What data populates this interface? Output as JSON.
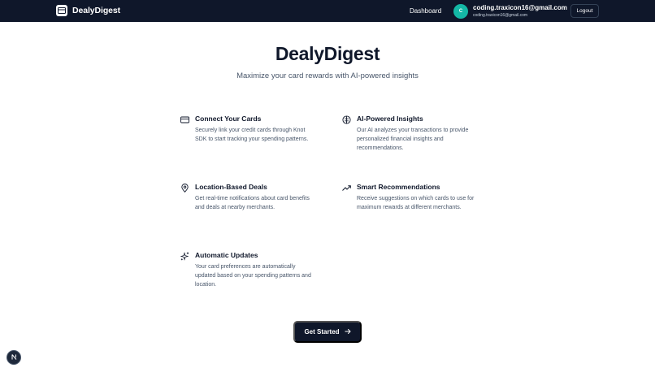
{
  "header": {
    "brand_name": "DealyDigest",
    "nav_dashboard": "Dashboard",
    "avatar_initial": "C",
    "user_email": "coding.traxicon16@gmail.com",
    "user_email_sub": "coding.traxicon16@gmail.com",
    "logout_label": "Logout"
  },
  "hero": {
    "title": "DealyDigest",
    "subtitle": "Maximize your card rewards with AI-powered insights"
  },
  "features": [
    {
      "icon": "credit-card-icon",
      "title": "Connect Your Cards",
      "description": "Securely link your credit cards through Knot SDK to start tracking your spending patterns."
    },
    {
      "icon": "brain-icon",
      "title": "AI-Powered Insights",
      "description": "Our AI analyzes your transactions to provide personalized financial insights and recommendations."
    },
    {
      "icon": "map-pin-icon",
      "title": "Location-Based Deals",
      "description": "Get real-time notifications about card benefits and deals at nearby merchants."
    },
    {
      "icon": "trending-up-icon",
      "title": "Smart Recommendations",
      "description": "Receive suggestions on which cards to use for maximum rewards at different merchants."
    },
    {
      "icon": "sparkles-icon",
      "title": "Automatic Updates",
      "description": "Your card preferences are automatically updated based on your spending patterns and location."
    }
  ],
  "cta": {
    "label": "Get Started",
    "icon": "arrow-right-icon"
  },
  "fab": {
    "label": "N",
    "icon": "next-logo-icon"
  },
  "colors": {
    "header_bg": "#0f172a",
    "avatar_bg": "#14b8a6",
    "text_primary": "#0f172a",
    "text_secondary": "#475569"
  }
}
